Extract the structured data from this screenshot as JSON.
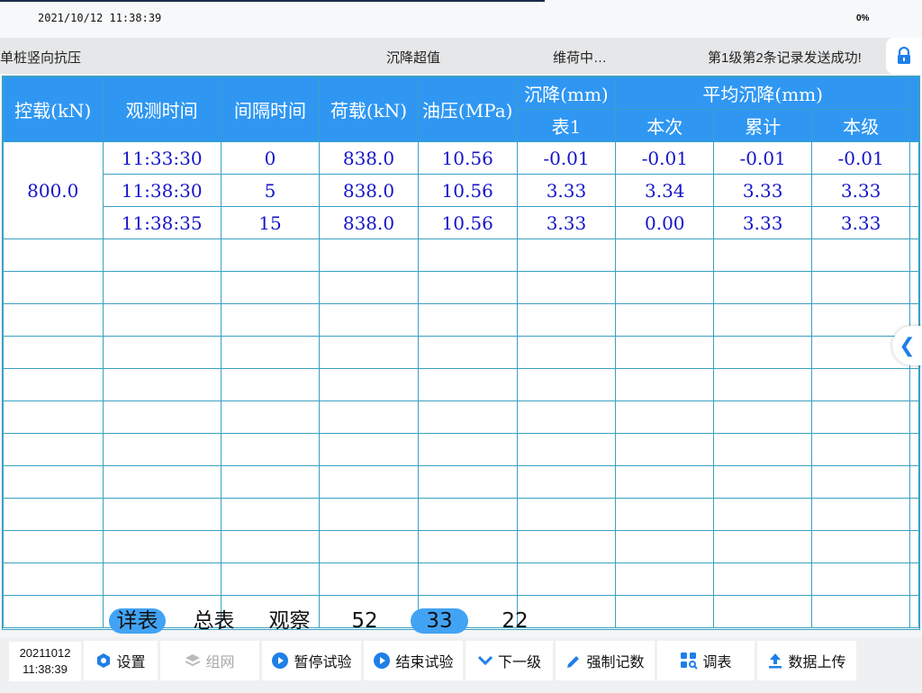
{
  "top": {
    "datetime": "2021/10/12 11:38:39",
    "battery": "0%"
  },
  "status": {
    "mode": "单桩竖向抗压",
    "alert": "沉降超值",
    "state": "维荷中…",
    "message": "第1级第2条记录发送成功!"
  },
  "table": {
    "headers": {
      "control_load": "控载(kN)",
      "obs_time": "观测时间",
      "interval": "间隔时间",
      "load": "荷载(kN)",
      "oil_pressure": "油压(MPa)",
      "settlement": "沉降(mm)",
      "avg_settlement": "平均沉降(mm)",
      "gauge1": "表1",
      "this_time": "本次",
      "cumulative": "累计",
      "this_level": "本级"
    },
    "control_load_value": "800.0",
    "rows": [
      {
        "time": "11:33:30",
        "interval": "0",
        "load": "838.0",
        "oil": "10.56",
        "gauge1": "-0.01",
        "this": "-0.01",
        "cum": "-0.01",
        "level": "-0.01"
      },
      {
        "time": "11:38:30",
        "interval": "5",
        "load": "838.0",
        "oil": "10.56",
        "gauge1": "3.33",
        "this": "3.34",
        "cum": "3.33",
        "level": "3.33"
      },
      {
        "time": "11:38:35",
        "interval": "15",
        "load": "838.0",
        "oil": "10.56",
        "gauge1": "3.33",
        "this": "0.00",
        "cum": "3.33",
        "level": "3.33"
      }
    ]
  },
  "tabs": [
    {
      "label": "详表",
      "active": true
    },
    {
      "label": "总表",
      "active": false
    },
    {
      "label": "观察",
      "active": false
    },
    {
      "label": "52",
      "active": false
    },
    {
      "label": "33",
      "active": true
    },
    {
      "label": "22",
      "active": false
    }
  ],
  "bottom": {
    "date": "20211012",
    "time": "11:38:39",
    "buttons": [
      {
        "label": "设置",
        "icon": "settings-hex-icon",
        "enabled": true
      },
      {
        "label": "组网",
        "icon": "layers-icon",
        "enabled": false
      },
      {
        "label": "暂停试验",
        "icon": "play-circle-icon",
        "enabled": true
      },
      {
        "label": "结束试验",
        "icon": "play-circle-icon",
        "enabled": true
      },
      {
        "label": "下一级",
        "icon": "chevron-down-icon",
        "enabled": true
      },
      {
        "label": "强制记数",
        "icon": "pencil-icon",
        "enabled": true
      },
      {
        "label": "调表",
        "icon": "grid-search-icon",
        "enabled": true
      },
      {
        "label": "数据上传",
        "icon": "upload-icon",
        "enabled": true
      }
    ]
  },
  "colors": {
    "header_blue": "#2f97f2",
    "data_text": "#1515c8",
    "grid_line": "#3aa0c2",
    "active_tab": "#42a3f5"
  }
}
